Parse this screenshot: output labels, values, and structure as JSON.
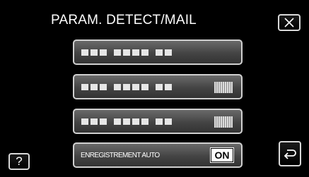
{
  "header": {
    "title": "PARAM. DETECT/MAIL",
    "close_icon": "close-icon"
  },
  "rows": [
    {
      "label": "",
      "value": ""
    },
    {
      "label": "",
      "value": ""
    },
    {
      "label": "",
      "value": ""
    },
    {
      "label": "ENREGISTREMENT AUTO",
      "value": "ON"
    }
  ],
  "footer": {
    "help_label": "?",
    "back_icon": "return-arrow-icon"
  },
  "colors": {
    "background": "#000000",
    "row_gradient_top": "#6a6a6a",
    "row_gradient_bottom": "#333333",
    "border": "#d0d0d0"
  }
}
